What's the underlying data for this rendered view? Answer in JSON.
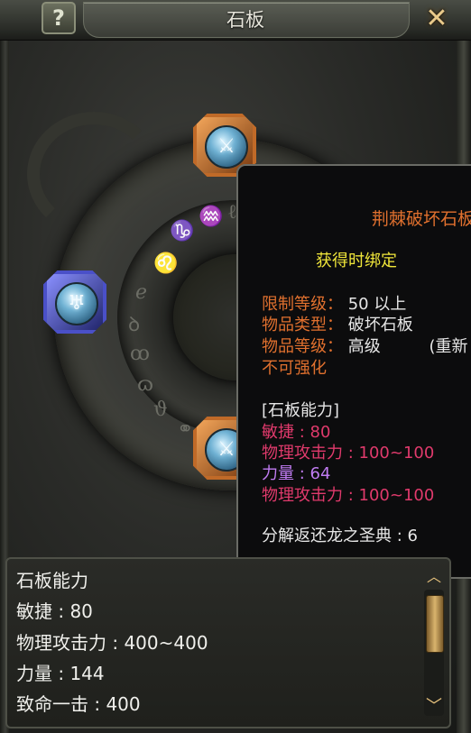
{
  "window": {
    "title": "石板",
    "help_label": "?",
    "close_label": "✕"
  },
  "sockets": [
    {
      "slot": "top",
      "color": "orange",
      "icon": "sword-gem-icon",
      "glyph": "⚔"
    },
    {
      "slot": "left",
      "color": "blue",
      "icon": "shield-gem-icon",
      "glyph": "♅"
    },
    {
      "slot": "bottom",
      "color": "orange",
      "icon": "sword-gem-icon",
      "glyph": "⚔"
    }
  ],
  "runes": [
    "♑",
    "♒",
    "♌",
    "ℯ",
    "ꝺ",
    "ꝏ",
    "ɷ",
    "ϑ",
    "⚭",
    "ℓ"
  ],
  "tooltip": {
    "name": "荆棘破坏石板",
    "bind_text": "获得时绑定",
    "rows": [
      {
        "key": "限制等级",
        "sep": "：",
        "value": "50 以上"
      },
      {
        "key": "物品类型",
        "sep": "：",
        "value": "破坏石板"
      },
      {
        "key": "物品等级",
        "sep": "：",
        "value": "高级",
        "extra": "(重新"
      }
    ],
    "not_enhanceable": "不可强化",
    "ability_header": "[石板能力]",
    "abilities": [
      {
        "text": "敏捷 : 80",
        "color": "red"
      },
      {
        "text": "物理攻击力 : 100~100",
        "color": "red"
      },
      {
        "text": "力量 : 64",
        "color": "purple"
      },
      {
        "text": "物理攻击力 : 100~100",
        "color": "red"
      }
    ],
    "decompose": "分解返还龙之圣典 : 6"
  },
  "summary": {
    "header": "石板能力",
    "lines": [
      "敏捷 : 80",
      "物理攻击力 : 400~400",
      "力量 : 144",
      "致命一击 : 400"
    ]
  },
  "scrollbar": {
    "up_icon": "︿",
    "down_icon": "﹀"
  },
  "colors": {
    "orange_text": "#e0702e",
    "yellow_text": "#f0e63a",
    "red_stat": "#e03a6c",
    "purple_stat": "#c07cf2",
    "orange_socket": "#c06a28",
    "blue_socket": "#4a50c8"
  }
}
